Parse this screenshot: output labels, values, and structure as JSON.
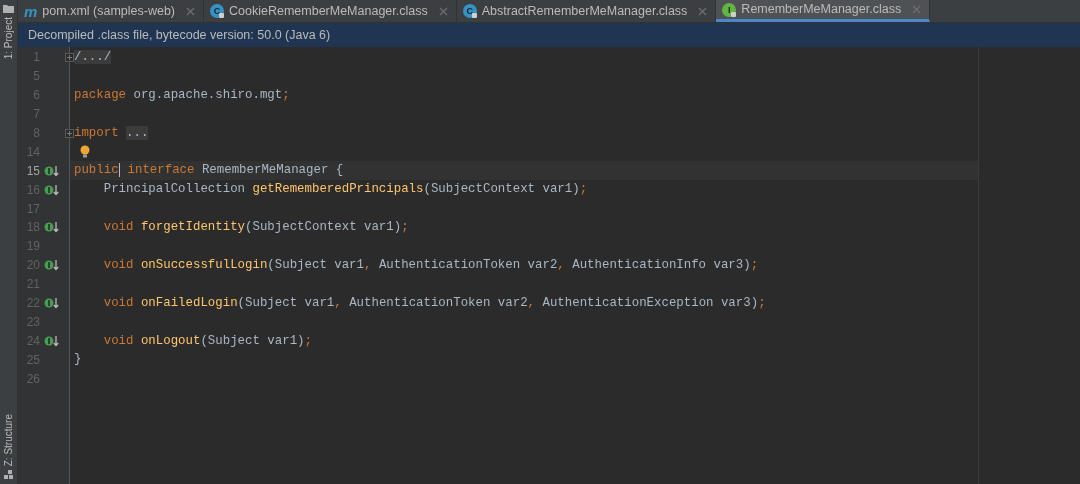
{
  "tool_strip": [
    {
      "label": "1: Project",
      "kind": "project"
    },
    {
      "label": "Z: Structure",
      "kind": "structure"
    }
  ],
  "tabs": [
    {
      "icon_letter": "m",
      "kind": "maven",
      "label": "pom.xml (samples-web)",
      "selected": false
    },
    {
      "icon_letter": "C",
      "kind": "class",
      "label": "CookieRememberMeManager.class",
      "selected": false
    },
    {
      "icon_letter": "C",
      "kind": "class",
      "label": "AbstractRememberMeManager.class",
      "selected": false
    },
    {
      "icon_letter": "I",
      "kind": "interface",
      "label": "RememberMeManager.class",
      "selected": true
    }
  ],
  "banner": "Decompiled .class file, bytecode version: 50.0 (Java 6)",
  "editor": {
    "lines": [
      {
        "number": "1",
        "fold": true,
        "marker": false,
        "current": false,
        "bulb": false,
        "tokens": [
          {
            "kind": "folded",
            "text": "/.../"
          }
        ]
      },
      {
        "number": "5",
        "fold": false,
        "marker": false,
        "current": false,
        "bulb": false
      },
      {
        "number": "6",
        "fold": false,
        "marker": false,
        "current": false,
        "bulb": false,
        "tokens": [
          {
            "kind": "keyword",
            "text": "package "
          },
          {
            "kind": "plain",
            "text": "org.apache.shiro.mgt"
          },
          {
            "kind": "punct",
            "text": ";"
          }
        ]
      },
      {
        "number": "7",
        "fold": false,
        "marker": false,
        "current": false,
        "bulb": false
      },
      {
        "number": "8",
        "fold": true,
        "marker": false,
        "current": false,
        "bulb": false,
        "tokens": [
          {
            "kind": "keyword",
            "text": "import "
          },
          {
            "kind": "folded",
            "text": "..."
          }
        ]
      },
      {
        "number": "14",
        "fold": false,
        "marker": false,
        "current": false,
        "bulb": true
      },
      {
        "number": "15",
        "fold": false,
        "marker": true,
        "current": true,
        "bulb": false,
        "tokens": [
          {
            "kind": "keyword",
            "text": "public",
            "caret": true
          },
          {
            "kind": "keyword",
            "text": " interface ",
            "caret": false
          },
          {
            "kind": "plain",
            "text": "RememberMeManager {",
            "caret": false
          }
        ]
      },
      {
        "number": "16",
        "fold": false,
        "marker": true,
        "current": false,
        "bulb": false,
        "tokens": [
          {
            "kind": "plain",
            "text": "    PrincipalCollection "
          },
          {
            "kind": "method",
            "text": "getRememberedPrincipals"
          },
          {
            "kind": "plain",
            "text": "(SubjectContext var1)"
          },
          {
            "kind": "punct",
            "text": ";"
          }
        ]
      },
      {
        "number": "17",
        "fold": false,
        "marker": false,
        "current": false,
        "bulb": false
      },
      {
        "number": "18",
        "fold": false,
        "marker": true,
        "current": false,
        "bulb": false,
        "tokens": [
          {
            "kind": "keyword",
            "text": "    void "
          },
          {
            "kind": "method",
            "text": "forgetIdentity"
          },
          {
            "kind": "plain",
            "text": "(SubjectContext var1)"
          },
          {
            "kind": "punct",
            "text": ";"
          }
        ]
      },
      {
        "number": "19",
        "fold": false,
        "marker": false,
        "current": false,
        "bulb": false
      },
      {
        "number": "20",
        "fold": false,
        "marker": true,
        "current": false,
        "bulb": false,
        "tokens": [
          {
            "kind": "keyword",
            "text": "    void "
          },
          {
            "kind": "method",
            "text": "onSuccessfulLogin"
          },
          {
            "kind": "plain",
            "text": "(Subject var1"
          },
          {
            "kind": "punct",
            "text": ", "
          },
          {
            "kind": "plain",
            "text": "AuthenticationToken var2"
          },
          {
            "kind": "punct",
            "text": ", "
          },
          {
            "kind": "plain",
            "text": "AuthenticationInfo var3)"
          },
          {
            "kind": "punct",
            "text": ";"
          }
        ]
      },
      {
        "number": "21",
        "fold": false,
        "marker": false,
        "current": false,
        "bulb": false
      },
      {
        "number": "22",
        "fold": false,
        "marker": true,
        "current": false,
        "bulb": false,
        "tokens": [
          {
            "kind": "keyword",
            "text": "    void "
          },
          {
            "kind": "method",
            "text": "onFailedLogin"
          },
          {
            "kind": "plain",
            "text": "(Subject var1"
          },
          {
            "kind": "punct",
            "text": ", "
          },
          {
            "kind": "plain",
            "text": "AuthenticationToken var2"
          },
          {
            "kind": "punct",
            "text": ", "
          },
          {
            "kind": "plain",
            "text": "AuthenticationException var3)"
          },
          {
            "kind": "punct",
            "text": ";"
          }
        ]
      },
      {
        "number": "23",
        "fold": false,
        "marker": false,
        "current": false,
        "bulb": false
      },
      {
        "number": "24",
        "fold": false,
        "marker": true,
        "current": false,
        "bulb": false,
        "tokens": [
          {
            "kind": "keyword",
            "text": "    void "
          },
          {
            "kind": "method",
            "text": "onLogout"
          },
          {
            "kind": "plain",
            "text": "(Subject var1)"
          },
          {
            "kind": "punct",
            "text": ";"
          }
        ]
      },
      {
        "number": "25",
        "fold": false,
        "marker": false,
        "current": false,
        "bulb": false,
        "tokens": [
          {
            "kind": "plain",
            "text": "}"
          }
        ]
      },
      {
        "number": "26",
        "fold": false,
        "marker": false,
        "current": false,
        "bulb": false
      }
    ]
  }
}
